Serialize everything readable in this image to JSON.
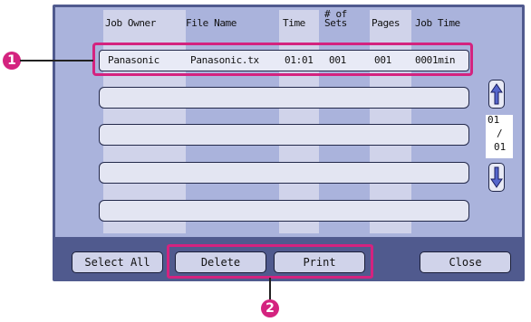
{
  "table": {
    "headers": {
      "job_owner": "Job Owner",
      "file_name": "File Name",
      "time": "Time",
      "sets_line1": "# of",
      "sets_line2": "Sets",
      "pages": "Pages",
      "job_time": "Job Time"
    },
    "rows": [
      {
        "job_owner": "Panasonic",
        "file_name": "Panasonic.tx",
        "time": "01:01",
        "sets": "001",
        "pages": "001",
        "job_time": "0001min"
      }
    ]
  },
  "pager": {
    "current": "01",
    "separator": "/",
    "total": "01"
  },
  "buttons": {
    "select_all": "Select All",
    "delete": "Delete",
    "print": "Print",
    "close": "Close"
  },
  "callouts": {
    "one": "1",
    "two": "2"
  },
  "colors": {
    "panel": "#505a8e",
    "screen": "#aab3dc",
    "highlight": "#d4237f"
  }
}
